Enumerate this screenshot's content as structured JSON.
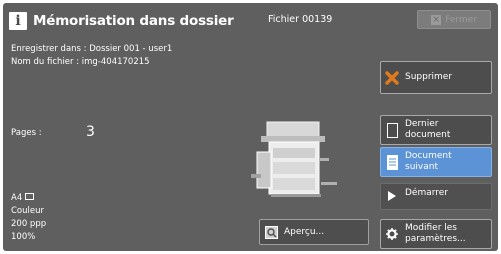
{
  "header": {
    "title": "Mémorisation dans dossier",
    "file_title": "Fichier 00139",
    "close_label": "Fermer"
  },
  "info": {
    "save_in": "Enregistrer dans : Dossier 001 - user1",
    "file_name": "Nom du fichier : img-404170215",
    "pages_label": "Pages :",
    "pages_value": "3",
    "paper": "A4",
    "color": "Couleur",
    "resolution": "200 ppp",
    "zoom": "100%"
  },
  "buttons": {
    "delete": "Supprimer",
    "last_doc_line1": "Dernier",
    "last_doc_line2": "document",
    "next_doc_line1": "Document",
    "next_doc_line2": "suivant",
    "start": "Démarrer",
    "preview": "Aperçu...",
    "modify_line1": "Modifier les",
    "modify_line2": "paramètres..."
  },
  "icons": {
    "info": "info-icon",
    "close": "close-icon",
    "delete": "delete-x-icon",
    "last_doc": "document-outline-icon",
    "next_doc": "document-lines-icon",
    "start": "play-icon",
    "preview": "preview-icon",
    "modify": "gear-icon",
    "machine": "printer-illustration"
  },
  "colors": {
    "panel": "#5f5f5f",
    "selected_button": "#5c92d6",
    "delete_icon": "#e07a1c"
  }
}
